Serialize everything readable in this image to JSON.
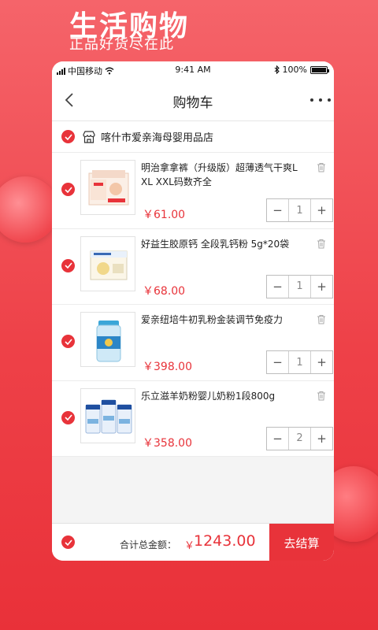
{
  "promo": {
    "title": "生活购物",
    "subtitle": "正品好货尽在此"
  },
  "status_bar": {
    "carrier": "中国移动",
    "time": "9:41 AM",
    "battery": "100%"
  },
  "nav": {
    "title": "购物车"
  },
  "store": {
    "name": "喀什市爱亲海母婴用品店"
  },
  "items": [
    {
      "title": "明治拿拿裤（升级版）超薄透气干爽L XL XXL码数齐全",
      "price": "￥61.00",
      "qty": "1",
      "icon": "diaper-pack-image"
    },
    {
      "title": "好益生胶原钙 全段乳钙粉 5g*20袋",
      "price": "￥68.00",
      "qty": "1",
      "icon": "calcium-powder-box-image"
    },
    {
      "title": "爱亲纽培牛初乳粉金装调节免疫力",
      "price": "￥398.00",
      "qty": "1",
      "icon": "colostrum-can-image"
    },
    {
      "title": "乐立滋羊奶粉婴儿奶粉1段800g",
      "price": "￥358.00",
      "qty": "2",
      "icon": "goat-milk-cans-image"
    }
  ],
  "stepper": {
    "minus": "−",
    "plus": "+"
  },
  "footer": {
    "total_label": "合计总金额：",
    "currency": "￥",
    "total_value": "1243.00",
    "checkout_label": "去结算"
  },
  "colors": {
    "accent": "#e8333a",
    "background_top": "#f5646a",
    "background_bottom": "#e93139"
  }
}
